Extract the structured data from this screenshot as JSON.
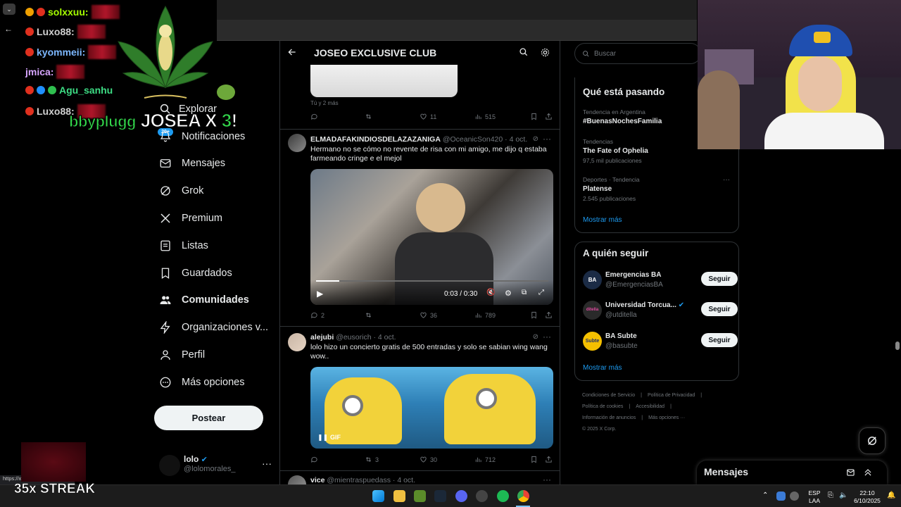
{
  "stream_overlay": {
    "chat": [
      {
        "user": "solxxuu:",
        "color": "#a6ff00"
      },
      {
        "user": "Luxo88:",
        "color": "#d0d0d0"
      },
      {
        "user": "kyommeii:",
        "color": "#7db8ff"
      },
      {
        "user": "jmica:",
        "color": "#d7a6ff"
      },
      {
        "user": "Agu_sanhu",
        "color": "#3ddc84"
      },
      {
        "user": "Luxo88:",
        "color": "#d0d0d0"
      }
    ],
    "title_prefix": "bbyplugg",
    "title_main": "JOSEA X",
    "title_num": "3",
    "title_suffix": "!",
    "badge": "20+",
    "streak": "35x STREAK"
  },
  "nav": {
    "items": [
      {
        "label": "Explorar",
        "icon": "search-icon"
      },
      {
        "label": "Notificaciones",
        "icon": "bell-icon"
      },
      {
        "label": "Mensajes",
        "icon": "mail-icon"
      },
      {
        "label": "Grok",
        "icon": "grok-icon"
      },
      {
        "label": "Premium",
        "icon": "x-icon"
      },
      {
        "label": "Listas",
        "icon": "list-icon"
      },
      {
        "label": "Guardados",
        "icon": "bookmark-icon"
      },
      {
        "label": "Comunidades",
        "icon": "people-icon"
      },
      {
        "label": "Organizaciones v...",
        "icon": "lightning-icon"
      },
      {
        "label": "Perfil",
        "icon": "person-icon"
      },
      {
        "label": "Más opciones",
        "icon": "more-circle-icon"
      }
    ],
    "post_button": "Postear",
    "profile_name": "lolo",
    "profile_handle": "@lolomorales_",
    "profile_more": "···"
  },
  "main": {
    "title": "JOSEO EXCLUSIVE CLUB",
    "prev_tweet": {
      "liked_by": "Tú y 2 más",
      "replies": "",
      "likes": "11",
      "views": "515"
    },
    "tweets": [
      {
        "name": "ELMADAFAKINDIOSDELAZAZANIGA",
        "handle": "@OceanicSon420",
        "date": "· 4 oct.",
        "text": "Hermano no se cómo no revente de risa con mi amigo, me dijo q estaba farmeando cringe e el mejol",
        "video_time": "0:03 / 0:30",
        "replies": "2",
        "retweets": "",
        "likes": "36",
        "views": "789"
      },
      {
        "name": "alejubi",
        "handle": "@eusorich",
        "date": "· 4 oct.",
        "text": "lolo hizo un concierto gratis de 500 entradas y solo se sabian wing wang wow..",
        "gif_label": "GIF",
        "replies": "",
        "retweets": "3",
        "likes": "30",
        "views": "712"
      },
      {
        "name": "vice",
        "handle": "@mientraspuedass",
        "date": "· 4 oct."
      }
    ]
  },
  "right": {
    "search_placeholder": "Buscar",
    "trends_title": "Qué está pasando",
    "trends": [
      {
        "category": "Tendencia en Argentina",
        "name": "#BuenasNochesFamilia",
        "count": ""
      },
      {
        "category": "Tendencias",
        "name": "The Fate of Ophelia",
        "count": "97,5 mil publicaciones"
      },
      {
        "category": "Deportes · Tendencia",
        "name": "Platense",
        "count": "2.545 publicaciones"
      }
    ],
    "show_more": "Mostrar más",
    "follow_title": "A quién seguir",
    "follow": [
      {
        "name": "Emergencias BA",
        "handle": "@EmergenciasBA",
        "button": "Seguir",
        "avatar_text": "BA",
        "avatar_bg": "#1b2b45"
      },
      {
        "name": "Universidad Torcua...",
        "handle": "@utditella",
        "button": "Seguir",
        "avatar_text": "ditella",
        "avatar_bg": "#2a2a2a"
      },
      {
        "name": "BA Subte",
        "handle": "@basubte",
        "button": "Seguir",
        "avatar_text": "Subte",
        "avatar_bg": "#f5c000"
      }
    ],
    "follow_more": "Mostrar más",
    "footer": [
      "Condiciones de Servicio",
      "|",
      "Política de Privacidad",
      "|",
      "Política de cookies",
      "|",
      "Accesibilidad",
      "|",
      "Información de anuncios",
      "|",
      "Más opciones ···",
      "© 2025 X Corp."
    ]
  },
  "messages_drawer": {
    "title": "Mensajes"
  },
  "status_bar_url": "https://x.com/OceanicSon420",
  "taskbar": {
    "lang_top": "ESP",
    "lang_bottom": "LAA",
    "time": "22:10",
    "date": "6/10/2025"
  },
  "colors": {
    "accent": "#1d9bf0",
    "verified": "#1d9bf0",
    "background": "#000000"
  }
}
